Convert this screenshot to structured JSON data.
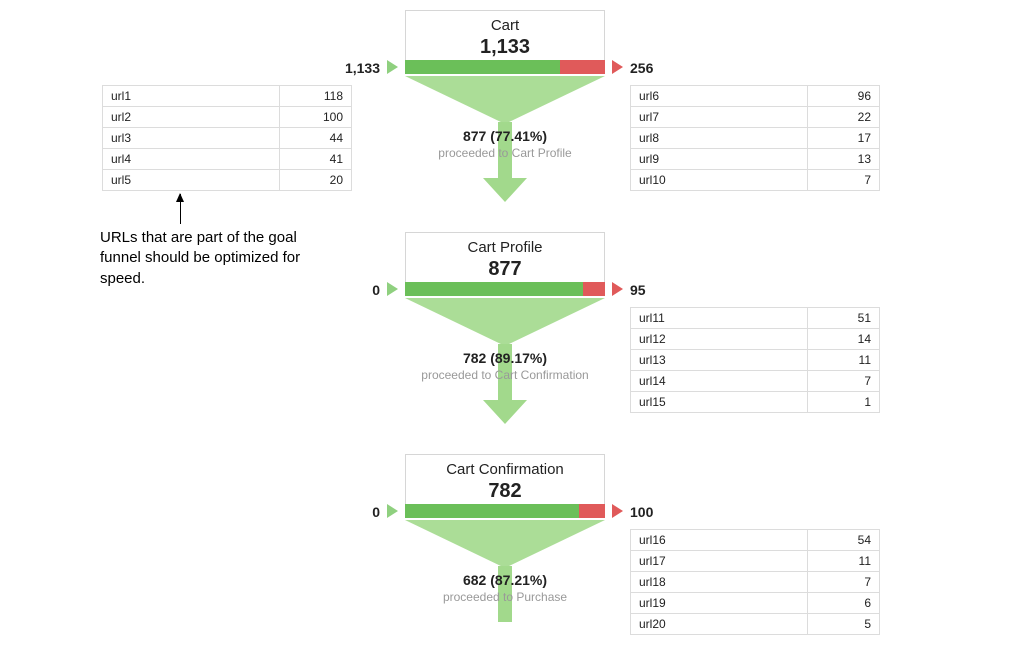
{
  "annotation": {
    "text": "URLs that are part of the goal funnel should be optimized for speed."
  },
  "stages": [
    {
      "title": "Cart",
      "count": "1,133",
      "entry": "1,133",
      "exit": "256",
      "bar_green_pct": 77.41,
      "proceed_count": "877 (77.41%)",
      "proceed_label": "proceeded to Cart Profile",
      "entry_urls": [
        {
          "url": "url1",
          "n": "118"
        },
        {
          "url": "url2",
          "n": "100"
        },
        {
          "url": "url3",
          "n": "44"
        },
        {
          "url": "url4",
          "n": "41"
        },
        {
          "url": "url5",
          "n": "20"
        }
      ],
      "exit_urls": [
        {
          "url": "url6",
          "n": "96"
        },
        {
          "url": "url7",
          "n": "22"
        },
        {
          "url": "url8",
          "n": "17"
        },
        {
          "url": "url9",
          "n": "13"
        },
        {
          "url": "url10",
          "n": "7"
        }
      ]
    },
    {
      "title": "Cart Profile",
      "count": "877",
      "entry": "0",
      "exit": "95",
      "bar_green_pct": 89.17,
      "proceed_count": "782 (89.17%)",
      "proceed_label": "proceeded to Cart Confirmation",
      "entry_urls": [],
      "exit_urls": [
        {
          "url": "url11",
          "n": "51"
        },
        {
          "url": "url12",
          "n": "14"
        },
        {
          "url": "url13",
          "n": "11"
        },
        {
          "url": "url14",
          "n": "7"
        },
        {
          "url": "url15",
          "n": "1"
        }
      ]
    },
    {
      "title": "Cart Confirmation",
      "count": "782",
      "entry": "0",
      "exit": "100",
      "bar_green_pct": 87.21,
      "proceed_count": "682 (87.21%)",
      "proceed_label": "proceeded to Purchase",
      "entry_urls": [],
      "exit_urls": [
        {
          "url": "url16",
          "n": "54"
        },
        {
          "url": "url17",
          "n": "11"
        },
        {
          "url": "url18",
          "n": "7"
        },
        {
          "url": "url19",
          "n": "6"
        },
        {
          "url": "url20",
          "n": "5"
        }
      ]
    }
  ]
}
